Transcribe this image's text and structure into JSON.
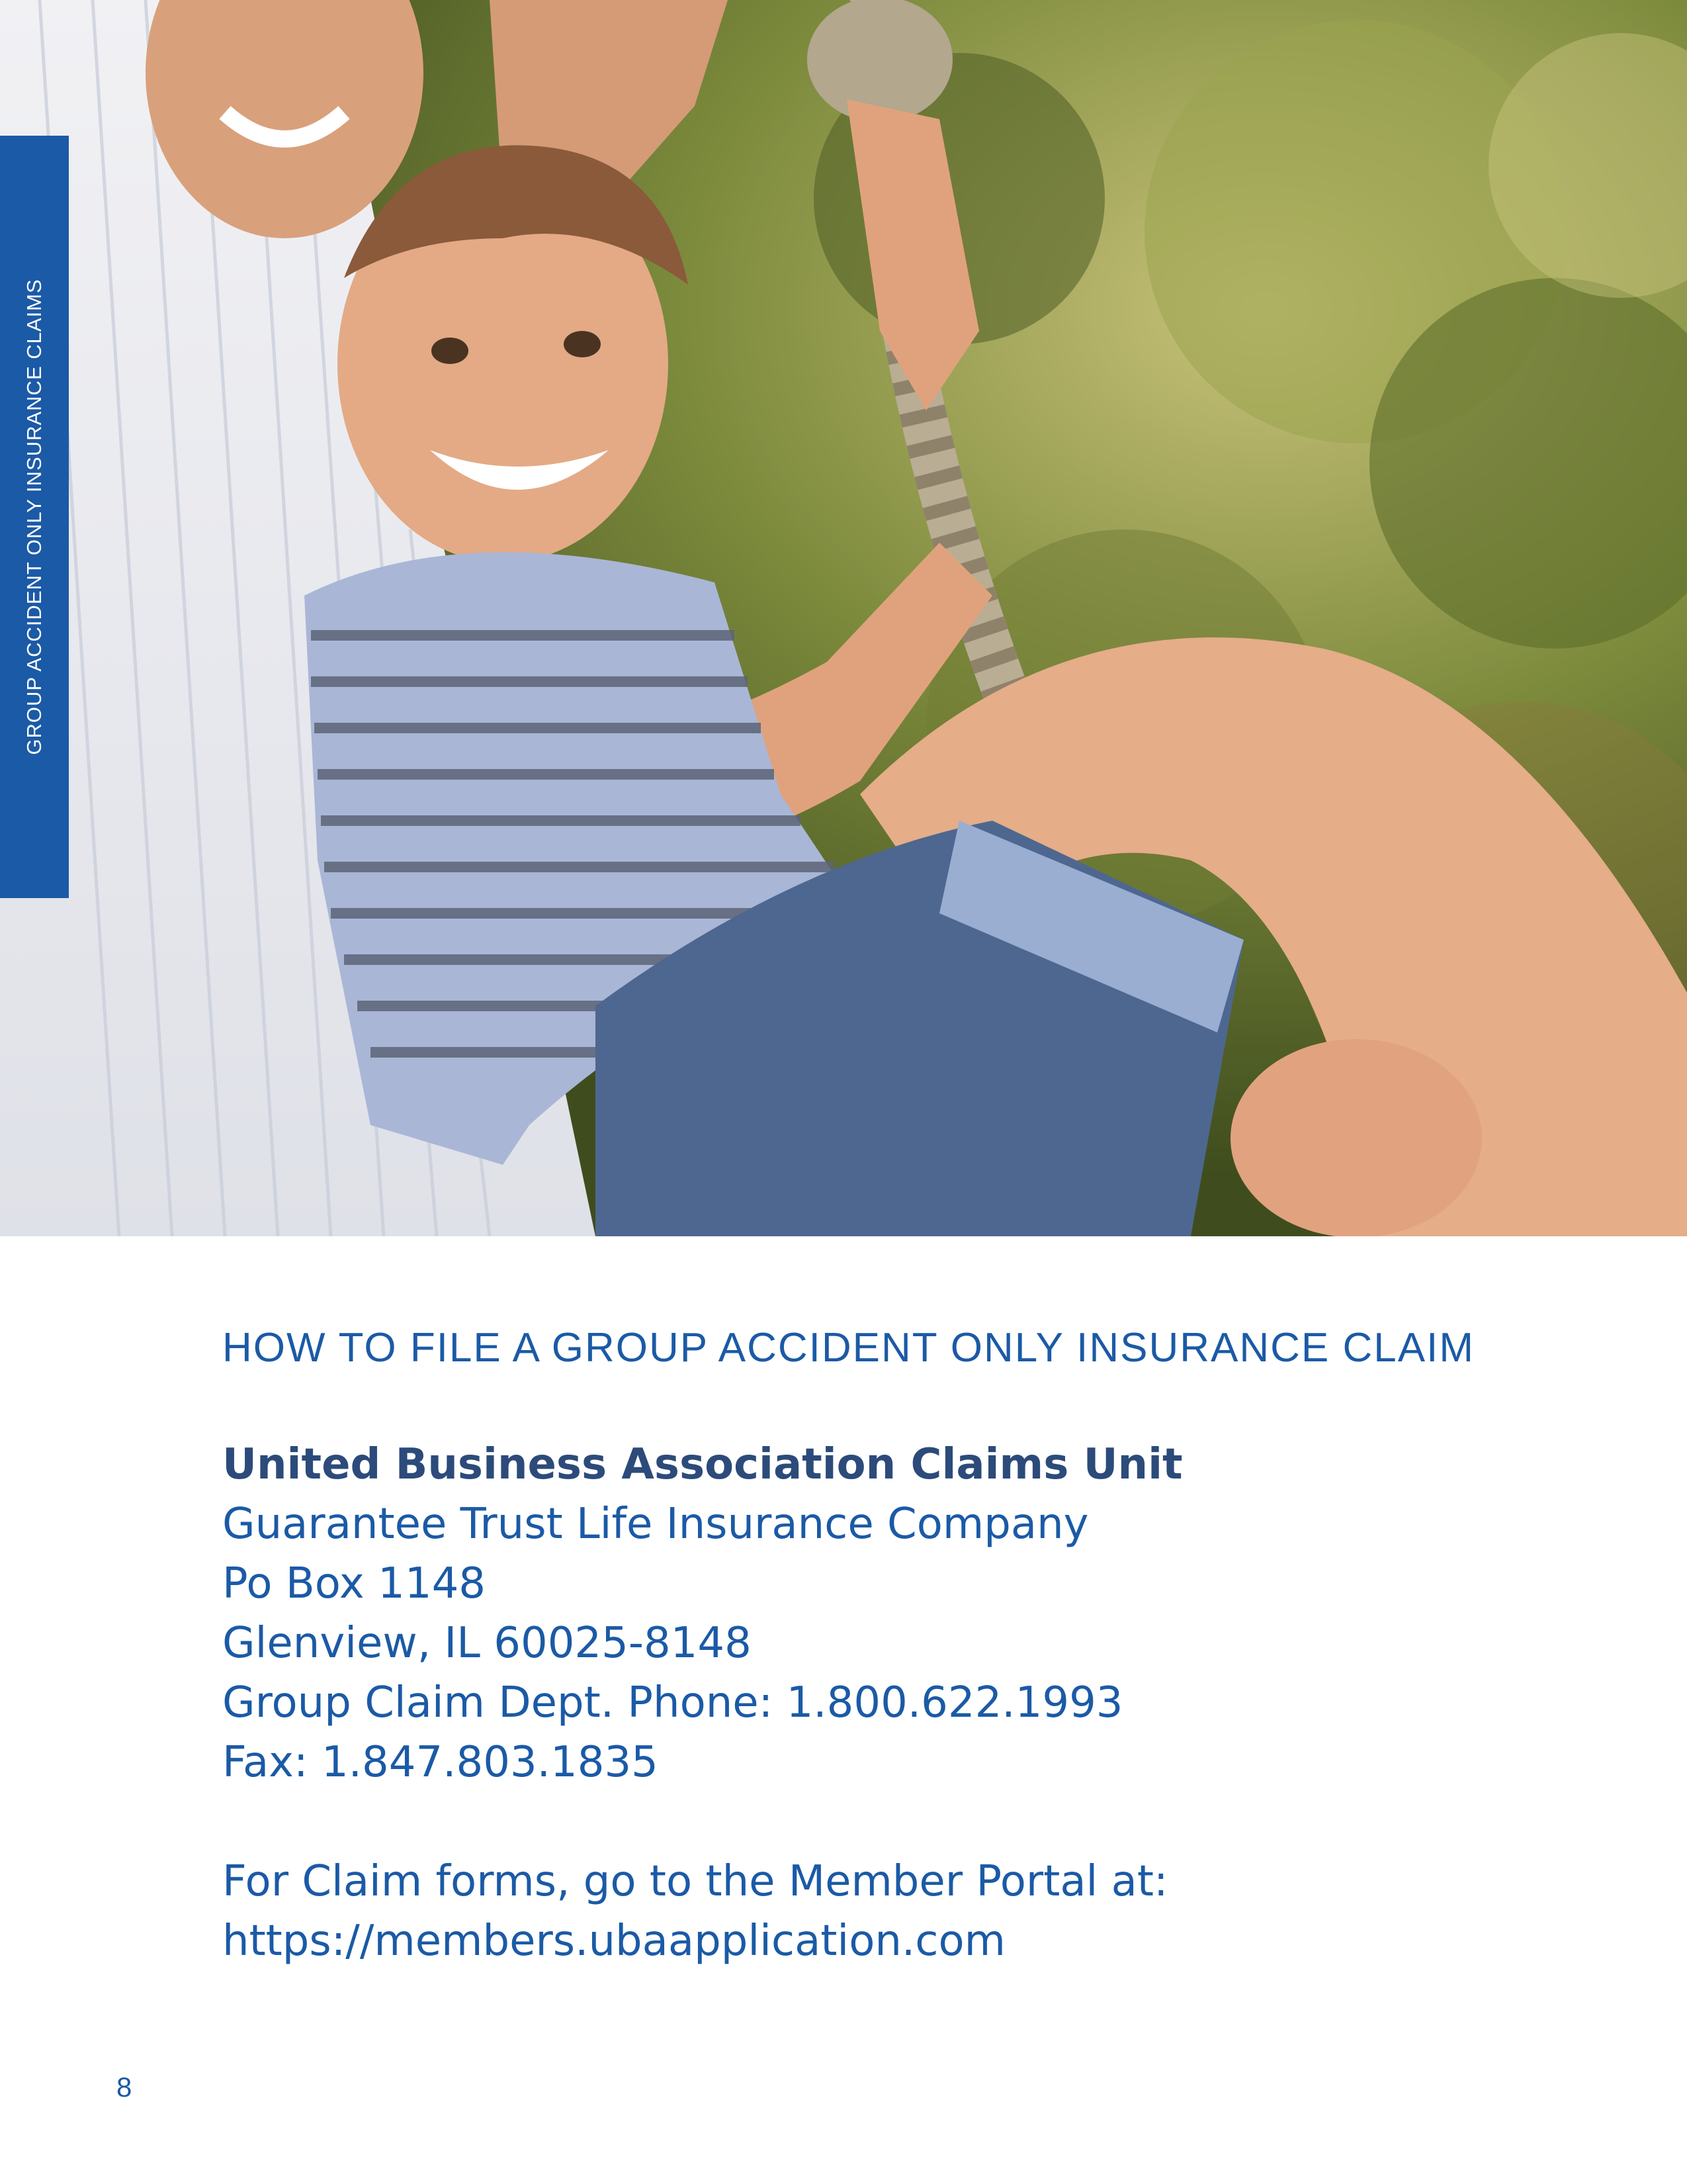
{
  "side_tab": {
    "label": "GROUP ACCIDENT ONLY INSURANCE CLAIMS"
  },
  "section": {
    "heading": "HOW TO FILE A GROUP ACCIDENT ONLY INSURANCE CLAIM"
  },
  "contact": {
    "unit_name": "United Business Association Claims Unit",
    "company": "Guarantee Trust Life Insurance Company",
    "po_box": "Po Box 1148",
    "city_state_zip": "Glenview, IL 60025-8148",
    "phone_line": "Group Claim Dept. Phone: 1.800.622.1993",
    "fax_line": "Fax: 1.847.803.1835"
  },
  "portal": {
    "intro": "For Claim forms, go to the Member Portal at:",
    "url": "https://members.ubaapplication.com"
  },
  "page": {
    "number": "8"
  },
  "colors": {
    "brand_blue": "#1b5aa6",
    "heading_navy": "#2c4b7a",
    "background": "#ffffff"
  }
}
